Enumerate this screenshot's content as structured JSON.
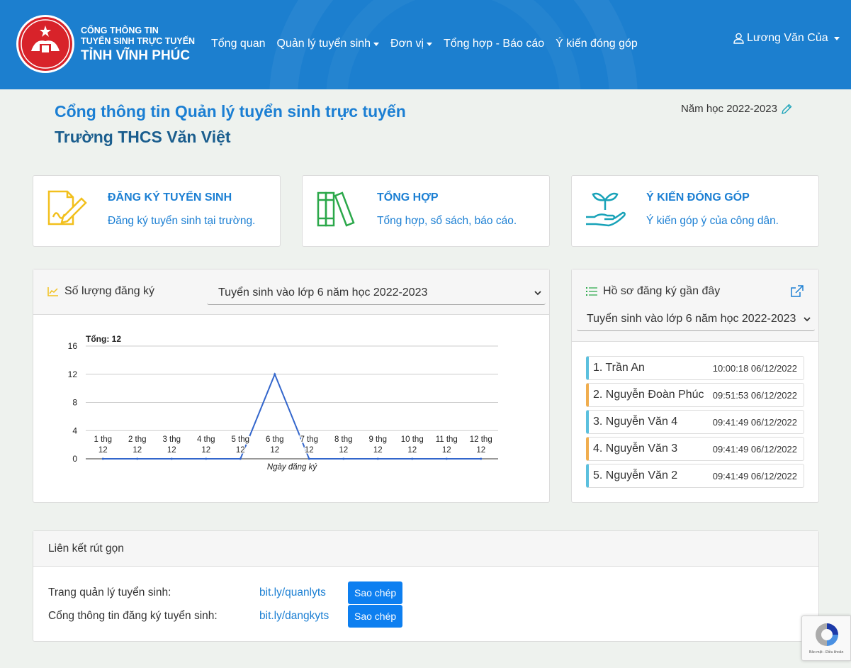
{
  "header": {
    "brand_line1": "CỔNG THÔNG TIN",
    "brand_line2": "TUYỂN SINH TRỰC TUYẾN",
    "brand_line3": "TỈNH VĨNH PHÚC",
    "nav": [
      {
        "label": "Tổng quan",
        "dropdown": false
      },
      {
        "label": "Quản lý tuyển sinh",
        "dropdown": true
      },
      {
        "label": "Đơn vị",
        "dropdown": true
      },
      {
        "label": "Tổng hợp - Báo cáo",
        "dropdown": false
      },
      {
        "label": "Ý kiến đóng góp",
        "dropdown": false
      }
    ],
    "user": "Lương Văn Của",
    "logo_text": "VĨNH PHÚC"
  },
  "page": {
    "title": "Cổng thông tin Quản lý tuyển sinh trực tuyến",
    "school": "Trường THCS Văn Việt",
    "year": "Năm học 2022-2023"
  },
  "features": [
    {
      "title": "ĐĂNG KÝ TUYỂN SINH",
      "desc": "Đăng ký tuyển sinh tại trường.",
      "icon": "signature-document-icon",
      "color": "#f2c01d"
    },
    {
      "title": "TỔNG HỢP",
      "desc": "Tổng hợp, sổ sách, báo cáo.",
      "icon": "books-icon",
      "color": "#2ba84a"
    },
    {
      "title": "Ý KIẾN ĐÓNG GÓP",
      "desc": "Ý kiến góp ý của công dân.",
      "icon": "plant-hand-icon",
      "color": "#17a2b8"
    }
  ],
  "chart_panel": {
    "label": "Số lượng đăng ký",
    "select_value": "Tuyển sinh vào lớp 6 năm học 2022-2023"
  },
  "chart_data": {
    "type": "line",
    "title": "Tổng: 12",
    "xlabel": "Ngày đăng ký",
    "ylabel": "",
    "categories": [
      "1 thg 12",
      "2 thg 12",
      "3 thg 12",
      "4 thg 12",
      "5 thg 12",
      "6 thg 12",
      "7 thg 12",
      "8 thg 12",
      "9 thg 12",
      "10 thg 12",
      "11 thg 12",
      "12 thg 12"
    ],
    "values": [
      0,
      0,
      0,
      0,
      0,
      12,
      0,
      0,
      0,
      0,
      0,
      0
    ],
    "ylim": [
      0,
      16
    ],
    "yticks": [
      0,
      4,
      8,
      12,
      16
    ],
    "grid": true,
    "color": "#3366cc"
  },
  "recent": {
    "label": "Hồ sơ đăng ký gần đây",
    "select_value": "Tuyển sinh vào lớp 6 năm học 2022-2023",
    "items": [
      {
        "name": "1. Trần An",
        "time": "10:00:18 06/12/2022",
        "color": "#5bc0de"
      },
      {
        "name": "2. Nguyễn Đoàn Phúc",
        "time": "09:51:53 06/12/2022",
        "color": "#f0ad4e"
      },
      {
        "name": "3. Nguyễn Văn 4",
        "time": "09:41:49 06/12/2022",
        "color": "#5bc0de"
      },
      {
        "name": "4. Nguyễn Văn 3",
        "time": "09:41:49 06/12/2022",
        "color": "#f0ad4e"
      },
      {
        "name": "5. Nguyễn Văn 2",
        "time": "09:41:49 06/12/2022",
        "color": "#5bc0de"
      }
    ]
  },
  "links": {
    "title": "Liên kết rút gọn",
    "rows": [
      {
        "label": "Trang quản lý tuyển sinh:",
        "url": "bit.ly/quanlyts",
        "button": "Sao chép"
      },
      {
        "label": "Cổng thông tin đăng ký tuyển sinh:",
        "url": "bit.ly/dangkyts",
        "button": "Sao chép"
      }
    ]
  },
  "recaptcha": {
    "text": "Bảo mật - Điều khoản"
  }
}
